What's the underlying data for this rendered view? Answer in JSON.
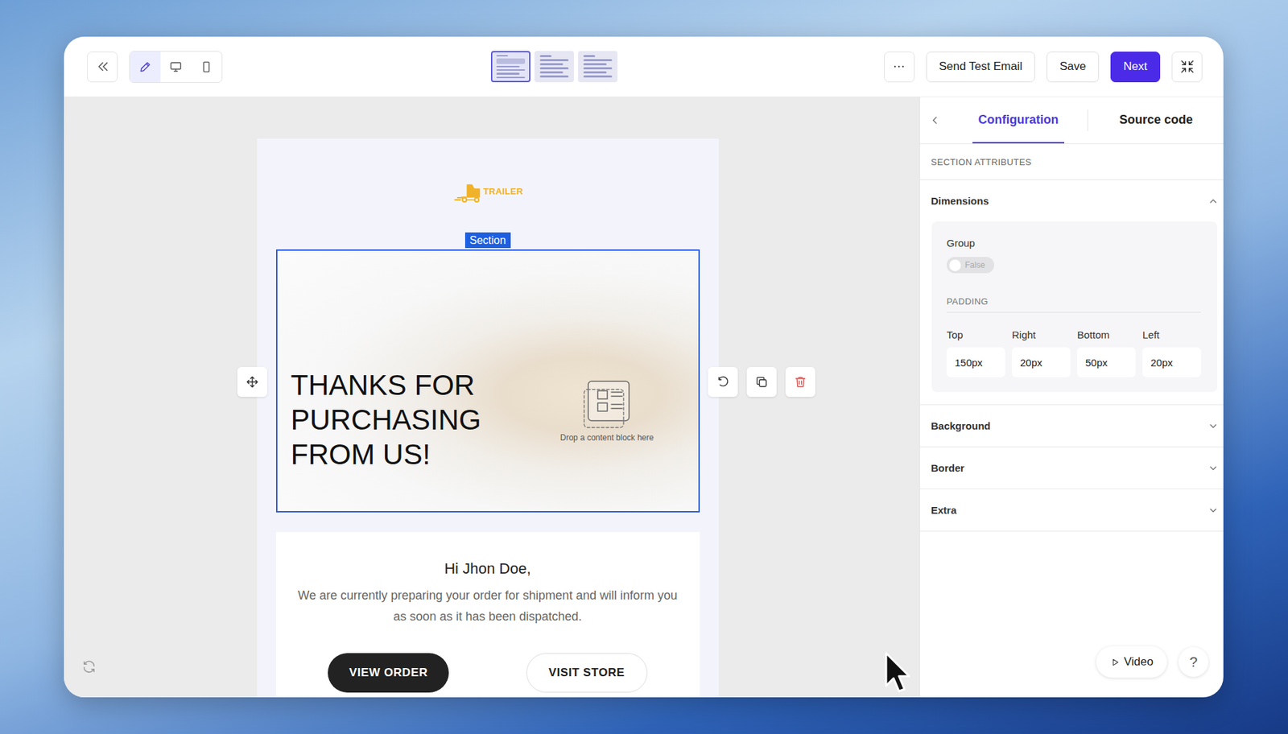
{
  "toolbar": {
    "view_modes": [
      {
        "selected": true
      },
      {
        "selected": false
      },
      {
        "selected": false
      }
    ],
    "templates": [
      {
        "selected": true
      },
      {
        "selected": false
      },
      {
        "selected": false
      }
    ],
    "buttons": [
      {
        "label": "Send Test Email",
        "kind": "outline"
      },
      {
        "label": "Save",
        "kind": "outline"
      },
      {
        "label": "Next",
        "kind": "primary"
      }
    ]
  },
  "email": {
    "logo_text": "TRAILER",
    "section_badge": "Section",
    "hero_lines": [
      "THANKS FOR",
      "PURCHASING",
      "FROM US!"
    ],
    "drop_hint": "Drop a content block here",
    "greeting": "Hi Jhon Doe,",
    "message": "We are currently preparing your order for shipment and will inform you as soon as it has been dispatched.",
    "buttons": [
      {
        "label": "VIEW ORDER",
        "kind": "filled"
      },
      {
        "label": "VISIT STORE",
        "kind": "outline"
      }
    ]
  },
  "panel": {
    "tabs": [
      {
        "label": "Configuration",
        "selected": true
      },
      {
        "label": "Source code",
        "selected": false
      }
    ],
    "heading": "SECTION ATTRIBUTES",
    "dimensions": {
      "label": "Dimensions",
      "expanded": true,
      "group": {
        "label": "Group",
        "on": false,
        "state_text": "False"
      },
      "padding_label": "PADDING",
      "padding": [
        {
          "label": "Top",
          "value": "150px"
        },
        {
          "label": "Right",
          "value": "20px"
        },
        {
          "label": "Bottom",
          "value": "50px"
        },
        {
          "label": "Left",
          "value": "20px"
        }
      ]
    },
    "groups": [
      {
        "label": "Background",
        "expanded": false
      },
      {
        "label": "Border",
        "expanded": false
      },
      {
        "label": "Extra",
        "expanded": false
      }
    ],
    "video": "Video",
    "help": "?"
  }
}
